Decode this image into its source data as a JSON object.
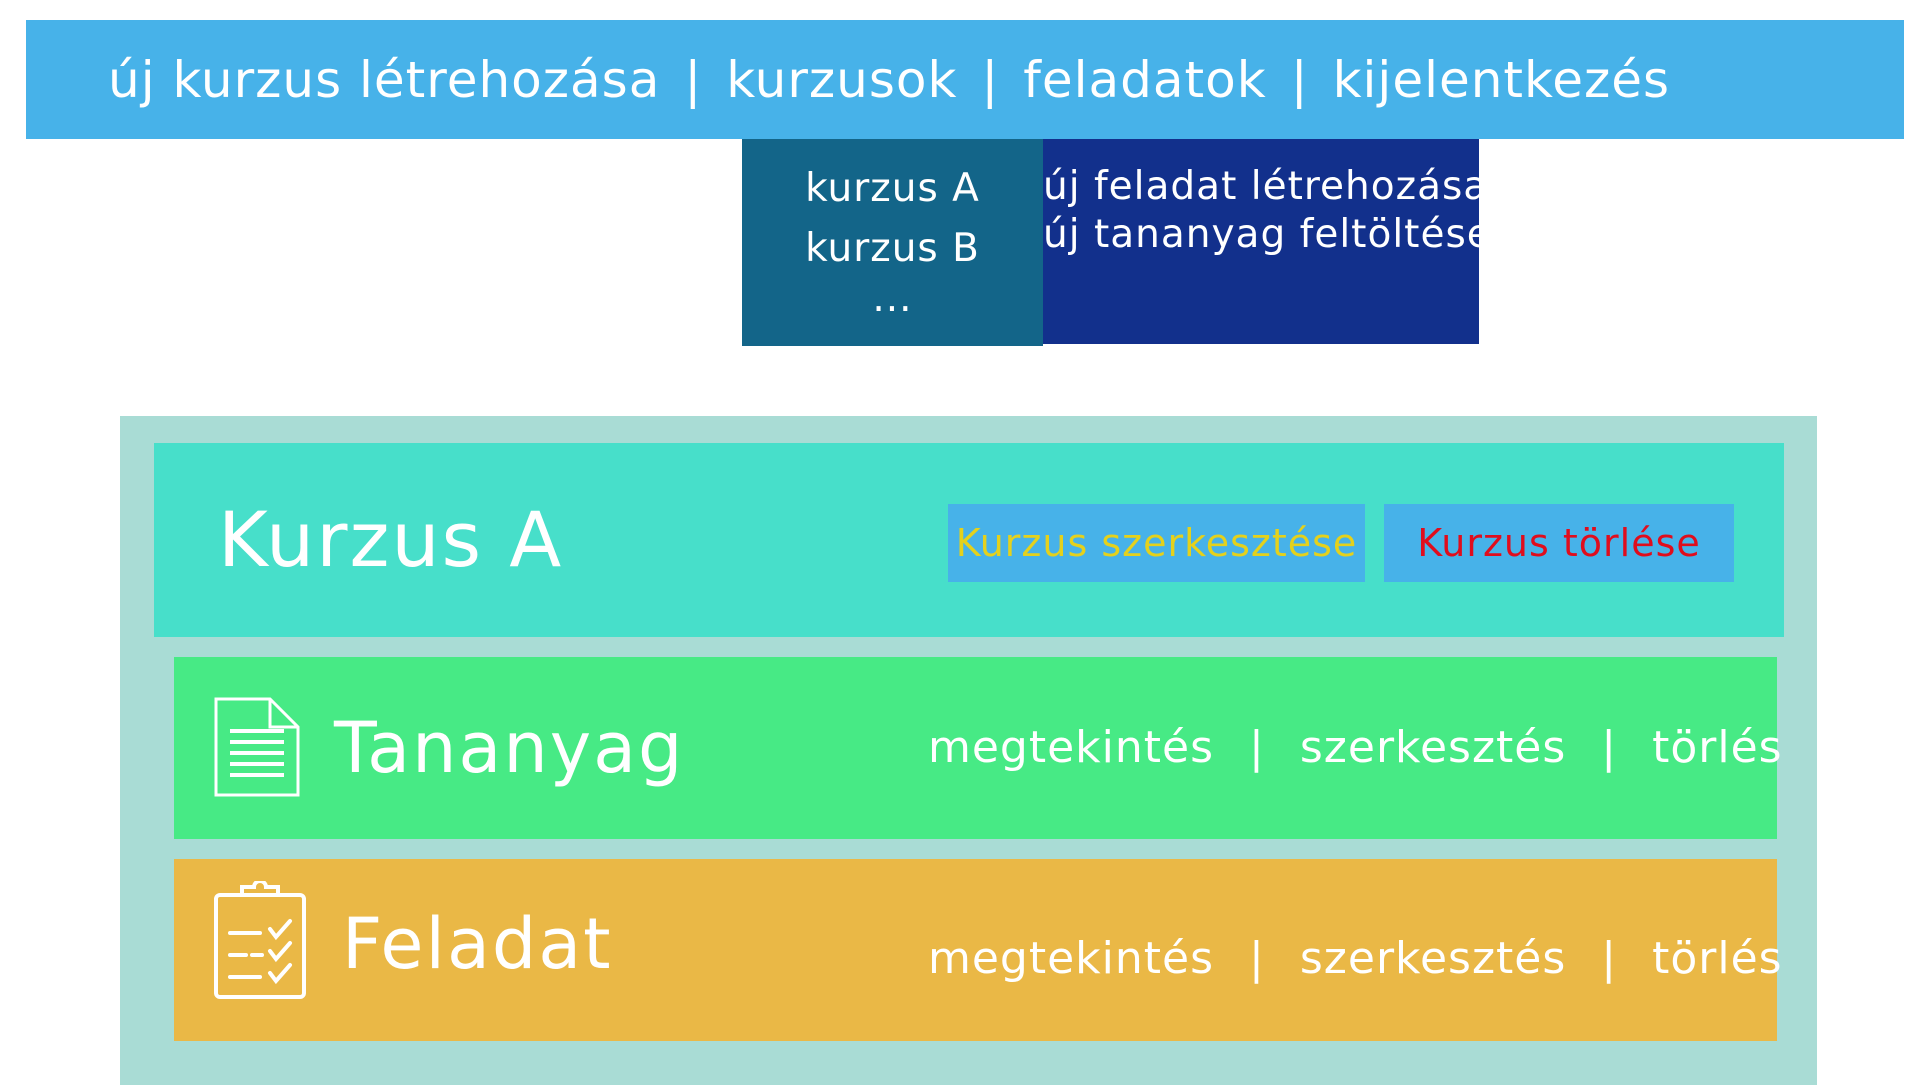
{
  "nav": {
    "items": [
      "új kurzus létrehozása",
      "kurzusok",
      "feladatok",
      "kijelentkezés"
    ],
    "separator": "|"
  },
  "courses_menu": {
    "items": [
      "kurzus A",
      "kurzus B"
    ],
    "more": "..."
  },
  "tasks_menu": {
    "items": [
      "új feladat létrehozása",
      "új tananyag feltöltése"
    ]
  },
  "course": {
    "title": "Kurzus A",
    "edit_label": "Kurzus szerkesztése",
    "delete_label": "Kurzus törlése"
  },
  "rows": [
    {
      "title": "Tananyag",
      "icon": "document-icon",
      "actions": [
        "megtekintés",
        "szerkesztés",
        "törlés"
      ]
    },
    {
      "title": "Feladat",
      "icon": "clipboard-check-icon",
      "actions": [
        "megtekintés",
        "szerkesztés",
        "törlés"
      ]
    }
  ],
  "colors": {
    "topbar": "#47b2e9",
    "courses_menu": "#136589",
    "tasks_menu": "#12308c",
    "outer_panel": "#a9dcd5",
    "course_header": "#47dfca",
    "material_row": "#47ea85",
    "task_row": "#eab846",
    "edit_text": "#e4d11c",
    "delete_text": "#e00d1d"
  }
}
